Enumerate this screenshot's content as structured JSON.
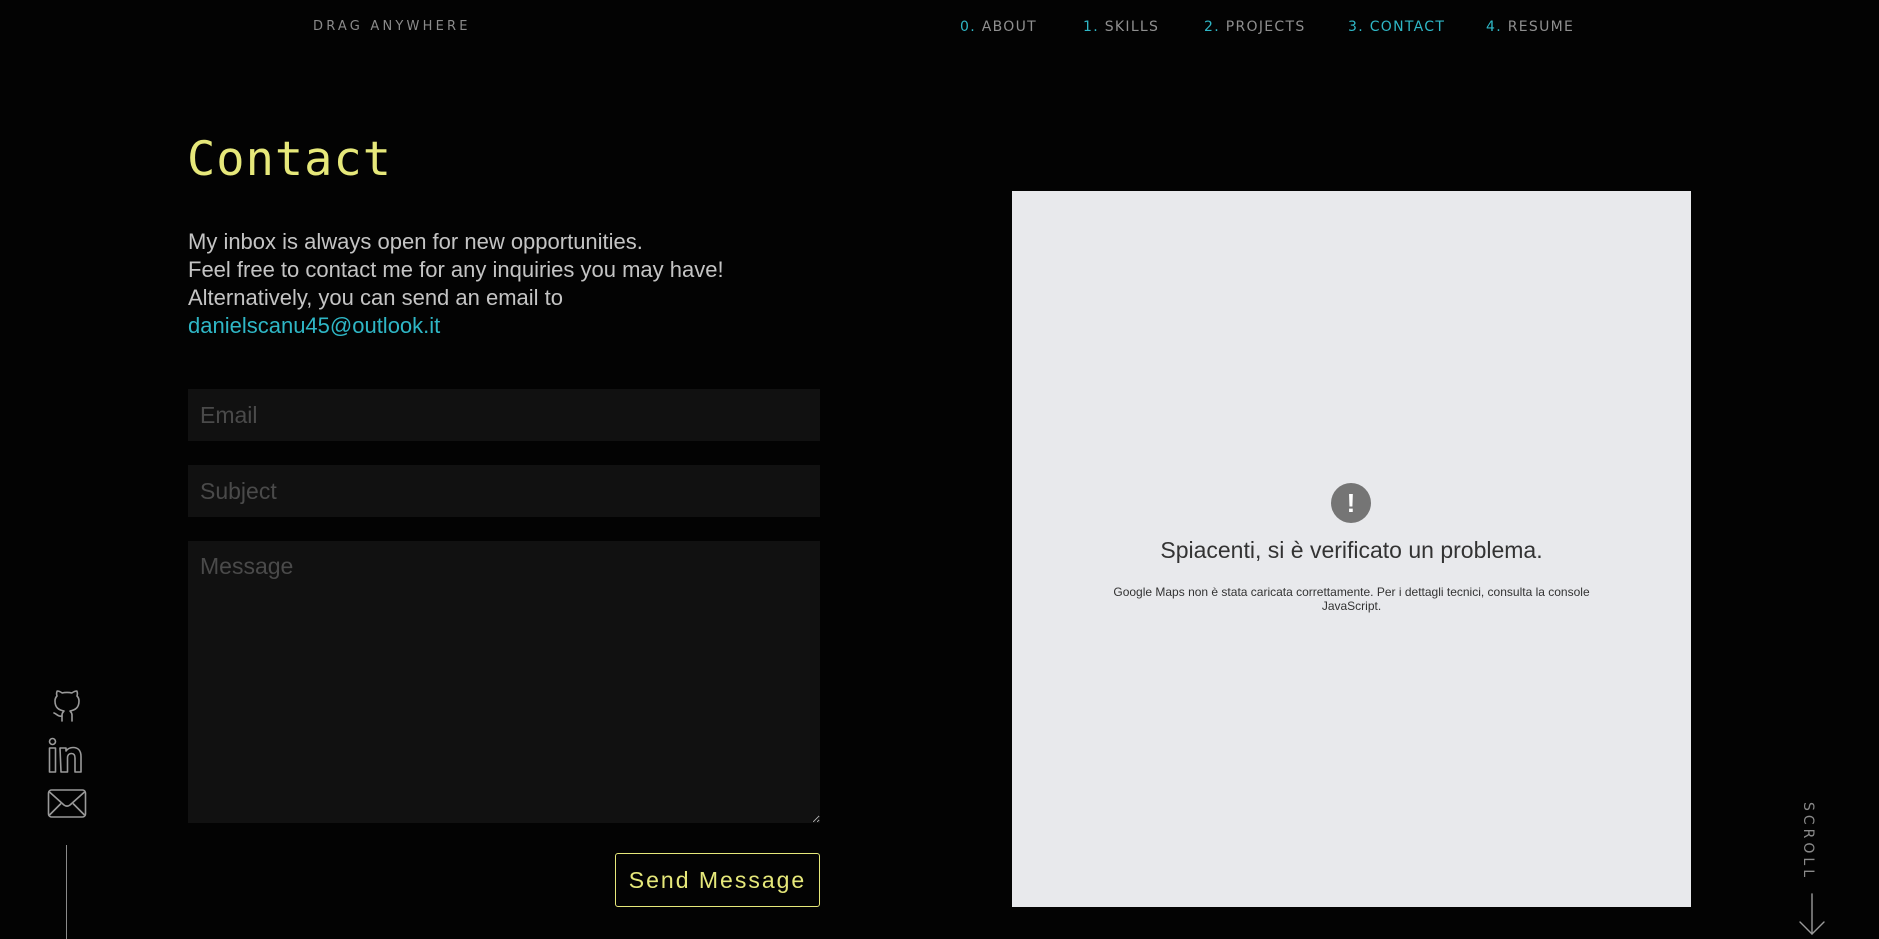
{
  "header": {
    "brand": "DRAG ANYWHERE",
    "nav": [
      {
        "num": "0.",
        "label": "ABOUT",
        "active": false
      },
      {
        "num": "1.",
        "label": "SKILLS",
        "active": false
      },
      {
        "num": "2.",
        "label": "PROJECTS",
        "active": false
      },
      {
        "num": "3.",
        "label": "CONTACT",
        "active": true
      },
      {
        "num": "4.",
        "label": "RESUME",
        "active": false
      }
    ]
  },
  "contact": {
    "title": "Contact",
    "intro_line1": "My inbox is always open for new opportunities.",
    "intro_line2": "Feel free to contact me for any inquiries you may have!",
    "intro_line3": "Alternatively, you can send an email to",
    "email_link": "danielscanu45@outlook.it",
    "form": {
      "email_placeholder": "Email",
      "email_value": "",
      "subject_placeholder": "Subject",
      "subject_value": "",
      "message_placeholder": "Message",
      "message_value": "",
      "send_label": "Send Message"
    }
  },
  "map": {
    "icon": "exclamation-icon",
    "error_title": "Spiacenti, si è verificato un problema.",
    "error_detail": "Google Maps non è stata caricata correttamente. Per i dettagli tecnici, consulta la console JavaScript."
  },
  "social": [
    {
      "name": "github-icon"
    },
    {
      "name": "linkedin-icon"
    },
    {
      "name": "mail-icon"
    }
  ],
  "scroll": {
    "label": "SCROLL",
    "icon": "arrow-down-icon"
  },
  "colors": {
    "accent_yellow": "#e6e87a",
    "accent_cyan": "#2fb7c6",
    "background": "#030303",
    "input_bg": "#111111",
    "map_bg": "#e8e9ec"
  }
}
